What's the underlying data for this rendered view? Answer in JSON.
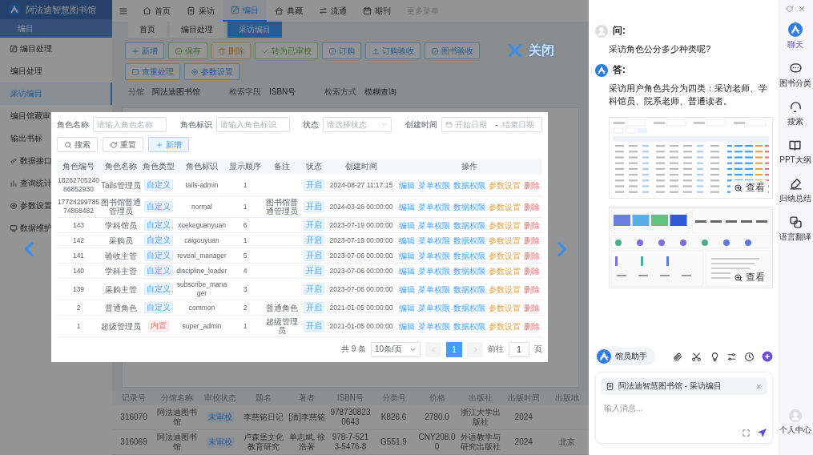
{
  "app": {
    "brand": "阿法迪智慧图书馆",
    "section": "编目",
    "sidebar": [
      {
        "label": "编目处理",
        "kind": "group",
        "selected": false
      },
      {
        "label": "编目处理",
        "kind": "item",
        "selected": false
      },
      {
        "label": "采访编目",
        "kind": "item",
        "selected": true
      },
      {
        "label": "编目馆藏审",
        "kind": "item",
        "selected": false
      },
      {
        "label": "输出书标",
        "kind": "item",
        "selected": false
      },
      {
        "label": "数据接口",
        "kind": "group",
        "selected": false
      },
      {
        "label": "查询统计",
        "kind": "group",
        "selected": false
      },
      {
        "label": "参数设置",
        "kind": "group",
        "selected": false
      },
      {
        "label": "数据维护",
        "kind": "group",
        "selected": false
      }
    ],
    "nav": [
      {
        "label": "首页",
        "selected": false,
        "disabled": false
      },
      {
        "label": "采访",
        "selected": false,
        "disabled": false
      },
      {
        "label": "编目",
        "selected": true,
        "disabled": false
      },
      {
        "label": "典藏",
        "selected": false,
        "disabled": false
      },
      {
        "label": "流通",
        "selected": false,
        "disabled": false
      },
      {
        "label": "期刊",
        "selected": false,
        "disabled": false
      },
      {
        "label": "更多菜单",
        "selected": false,
        "disabled": true
      }
    ],
    "tabs": [
      {
        "label": "首页",
        "selected": false
      },
      {
        "label": "编目处理",
        "selected": false
      },
      {
        "label": "采访编目",
        "selected": true
      }
    ],
    "toolbar": [
      {
        "label": "新增",
        "kind": "primary"
      },
      {
        "label": "保存",
        "kind": "success"
      },
      {
        "label": "删除",
        "kind": "warning"
      },
      {
        "label": "转为已审校",
        "kind": "success"
      },
      {
        "label": "订购",
        "kind": "primary"
      },
      {
        "label": "订购验收",
        "kind": "primary"
      },
      {
        "label": "图书验收",
        "kind": "primary"
      },
      {
        "label": "查重处理",
        "kind": "primary"
      },
      {
        "label": "参数设置",
        "kind": "primary"
      }
    ],
    "filters": [
      {
        "label": "分馆",
        "value": "阿法迪图书馆"
      },
      {
        "label": "检索字段",
        "value": "ISBN号"
      },
      {
        "label": "检索方式",
        "value": "模糊查询"
      }
    ],
    "records": {
      "columns": [
        {
          "label": "记录号",
          "kind": "text"
        },
        {
          "label": "分馆名称",
          "kind": "text"
        },
        {
          "label": "审校状态",
          "kind": "tag"
        },
        {
          "label": "题名",
          "kind": "text"
        },
        {
          "label": "著者",
          "kind": "text"
        },
        {
          "label": "ISBN号",
          "kind": "text"
        },
        {
          "label": "分类号",
          "kind": "text"
        },
        {
          "label": "价格",
          "kind": "text"
        },
        {
          "label": "出版社",
          "kind": "text"
        },
        {
          "label": "出版时间",
          "kind": "text"
        },
        {
          "label": "出版地",
          "kind": "text"
        }
      ],
      "rows": [
        {
          "cells": [
            "316070",
            "阿法迪图书馆",
            "未审校",
            "李慈铭日记",
            "[清]李慈铭",
            "9787308230643",
            "K826.6",
            "2780.0",
            "浙江大学出版社",
            "2024"
          ]
        },
        {
          "cells": [
            "316069",
            "阿法迪图书馆",
            "未审校",
            "卢森堡文化教育研究",
            "单志斌, 徐浩著",
            "978-7-5213-5476-8",
            "G551.9",
            "CNY208.00",
            "外语教学与研究出版社",
            "2024",
            "北京"
          ]
        }
      ]
    }
  },
  "lightbox": {
    "close_label": "关闭",
    "screenshot": {
      "filters": [
        {
          "label": "角色名称",
          "kind": "text",
          "placeholder": "请输入角色名称"
        },
        {
          "label": "角色标识",
          "kind": "text",
          "placeholder": "请输入角色标识"
        },
        {
          "label": "状态",
          "kind": "select",
          "placeholder": "请选择状态"
        },
        {
          "label": "创建时间",
          "kind": "daterange",
          "placeholder": "开始日期",
          "placeholder_end": "结束日期",
          "separator": "-"
        }
      ],
      "buttons": [
        {
          "label": "搜索",
          "kind": "search"
        },
        {
          "label": "重置",
          "kind": "reset"
        },
        {
          "label": "新增",
          "kind": "add"
        }
      ],
      "table": {
        "columns": [
          "角色编号",
          "角色名称",
          "角色类型",
          "角色标识",
          "显示顺序",
          "备注",
          "状态",
          "创建时间",
          "操作"
        ],
        "rows": [
          {
            "id": "1828270524086852930",
            "name": "Tails管理员",
            "type": {
              "label": "自定义",
              "kind": "custom"
            },
            "key": "tails-admin",
            "order": "1",
            "status": "开启",
            "created": "2024-08-27 11:17:15",
            "actions": [
              {
                "label": "编辑",
                "kind": "primary"
              },
              {
                "label": "菜单权限",
                "kind": "primary"
              },
              {
                "label": "数据权限",
                "kind": "primary"
              },
              {
                "label": "参数设置",
                "kind": "warning"
              },
              {
                "label": "删除",
                "kind": "danger"
              }
            ]
          },
          {
            "id": "1772429978574868482",
            "name": "图书馆普通管理员",
            "type": {
              "label": "自定义",
              "kind": "custom"
            },
            "key": "normal",
            "order": "1",
            "note": "图书馆普通管理员",
            "status": "开启",
            "created": "2024-03-26 00:00:00",
            "actions": [
              {
                "label": "编辑",
                "kind": "primary"
              },
              {
                "label": "菜单权限",
                "kind": "primary"
              },
              {
                "label": "数据权限",
                "kind": "primary"
              },
              {
                "label": "参数设置",
                "kind": "warning"
              },
              {
                "label": "删除",
                "kind": "danger"
              }
            ]
          },
          {
            "id": "143",
            "name": "学科馆员",
            "type": {
              "label": "自定义",
              "kind": "custom"
            },
            "key": "xuekeguanyuan",
            "order": "6",
            "status": "开启",
            "created": "2023-07-19 00:00:00",
            "actions": [
              {
                "label": "编辑",
                "kind": "primary"
              },
              {
                "label": "菜单权限",
                "kind": "primary"
              },
              {
                "label": "数据权限",
                "kind": "primary"
              },
              {
                "label": "参数设置",
                "kind": "warning"
              },
              {
                "label": "删除",
                "kind": "danger"
              }
            ]
          },
          {
            "id": "142",
            "name": "采购员",
            "type": {
              "label": "自定义",
              "kind": "custom"
            },
            "key": "caigouyuan",
            "order": "1",
            "status": "开启",
            "created": "2023-07-19 00:00:00",
            "actions": [
              {
                "label": "编辑",
                "kind": "primary"
              },
              {
                "label": "菜单权限",
                "kind": "primary"
              },
              {
                "label": "数据权限",
                "kind": "primary"
              },
              {
                "label": "参数设置",
                "kind": "warning"
              },
              {
                "label": "删除",
                "kind": "danger"
              }
            ]
          },
          {
            "id": "141",
            "name": "验收主管",
            "type": {
              "label": "自定义",
              "kind": "custom"
            },
            "key": "reveal_manager",
            "order": "5",
            "status": "开启",
            "created": "2023-07-06 00:00:00",
            "actions": [
              {
                "label": "编辑",
                "kind": "primary"
              },
              {
                "label": "菜单权限",
                "kind": "primary"
              },
              {
                "label": "数据权限",
                "kind": "primary"
              },
              {
                "label": "参数设置",
                "kind": "warning"
              },
              {
                "label": "删除",
                "kind": "danger"
              }
            ]
          },
          {
            "id": "140",
            "name": "学科主管",
            "type": {
              "label": "自定义",
              "kind": "custom"
            },
            "key": "discipline_leader",
            "order": "4",
            "status": "开启",
            "created": "2023-07-06 00:00:00",
            "actions": [
              {
                "label": "编辑",
                "kind": "primary"
              },
              {
                "label": "菜单权限",
                "kind": "primary"
              },
              {
                "label": "数据权限",
                "kind": "primary"
              },
              {
                "label": "参数设置",
                "kind": "warning"
              },
              {
                "label": "删除",
                "kind": "danger"
              }
            ]
          },
          {
            "id": "139",
            "name": "采购主管",
            "type": {
              "label": "自定义",
              "kind": "custom"
            },
            "key": "subscribe_manager",
            "order": "3",
            "status": "开启",
            "created": "2023-07-06 00:00:00",
            "actions": [
              {
                "label": "编辑",
                "kind": "primary"
              },
              {
                "label": "菜单权限",
                "kind": "primary"
              },
              {
                "label": "数据权限",
                "kind": "primary"
              },
              {
                "label": "参数设置",
                "kind": "warning"
              },
              {
                "label": "删除",
                "kind": "danger"
              }
            ]
          },
          {
            "id": "2",
            "name": "普通角色",
            "type": {
              "label": "自定义",
              "kind": "custom"
            },
            "key": "common",
            "order": "2",
            "note": "普通角色",
            "status": "开启",
            "created": "2021-01-05 00:00:00",
            "actions": [
              {
                "label": "编辑",
                "kind": "primary"
              },
              {
                "label": "菜单权限",
                "kind": "primary"
              },
              {
                "label": "数据权限",
                "kind": "primary"
              },
              {
                "label": "参数设置",
                "kind": "warning"
              },
              {
                "label": "删除",
                "kind": "danger"
              }
            ]
          },
          {
            "id": "1",
            "name": "超级管理员",
            "type": {
              "label": "内置",
              "kind": "builtin"
            },
            "key": "super_admin",
            "order": "1",
            "note": "超级管理员",
            "status": "开启",
            "created": "2021-01-05 00:00:00",
            "actions": [
              {
                "label": "编辑",
                "kind": "primary"
              },
              {
                "label": "菜单权限",
                "kind": "primary"
              },
              {
                "label": "数据权限",
                "kind": "primary"
              },
              {
                "label": "参数设置",
                "kind": "warning"
              },
              {
                "label": "删除",
                "kind": "danger"
              }
            ]
          }
        ]
      },
      "pagination": {
        "total": "共 9 条",
        "page_size": "10条/页",
        "pages": [
          {
            "label": "1",
            "selected": true
          }
        ],
        "jump_label": "前往",
        "jump_value": "1",
        "page_unit": "页"
      }
    }
  },
  "chat": {
    "messages": [
      {
        "kind": "question",
        "label": "问:",
        "text": "采访角色公分多少种类呢?"
      },
      {
        "kind": "answer",
        "label": "答:",
        "text": "采访用户角色共分为四类：采访老师、学科馆员、院系老师、普通读者。",
        "attachments": [
          {
            "kind": "table",
            "action": "查看"
          },
          {
            "kind": "dashboard",
            "action": "查看"
          }
        ]
      }
    ],
    "assistant": "馆员助手",
    "context": "阿法迪智慧图书馆 - 采访编目",
    "placeholder": "输入消息..."
  },
  "rail": {
    "items": [
      {
        "label": "聊天",
        "selected": true
      },
      {
        "label": "图书分类",
        "selected": false
      },
      {
        "label": "搜索",
        "selected": false
      },
      {
        "label": "PPT大纲",
        "selected": false
      },
      {
        "label": "归纳总结",
        "selected": false
      },
      {
        "label": "语言翻译",
        "selected": false
      }
    ],
    "profile": "个人中心"
  }
}
